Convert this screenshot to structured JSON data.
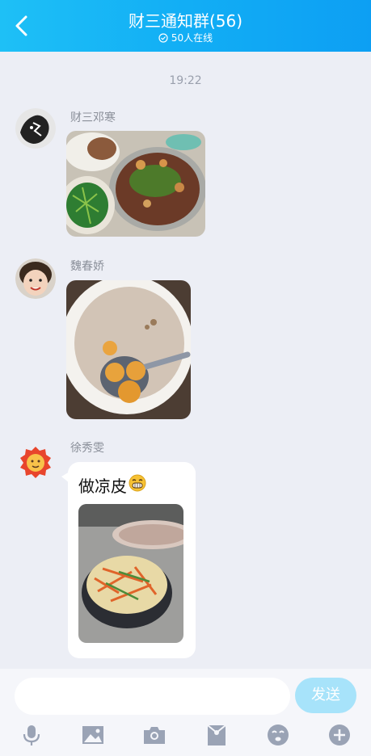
{
  "header": {
    "title": "财三通知群(56)",
    "online": "50人在线"
  },
  "timestamp": "19:22",
  "messages": [
    {
      "sender": "财三邓寒",
      "type": "image",
      "image": "food-dish-photo"
    },
    {
      "sender": "魏春娇",
      "type": "image",
      "image": "sweet-soup-bowl-photo"
    },
    {
      "sender": "徐秀雯",
      "type": "text-image",
      "text": "做凉皮",
      "emoji": "grinning-emoji",
      "image": "liangpi-noodles-photo"
    }
  ],
  "input": {
    "value": "",
    "send_label": "发送"
  },
  "toolbar": [
    "mic-icon",
    "image-icon",
    "camera-icon",
    "red-packet-icon",
    "emoji-icon",
    "plus-icon"
  ],
  "colors": {
    "header": "#12aef5",
    "background": "#eceef5",
    "send": "#a7e3fa",
    "icons": "#9aa3b5"
  }
}
